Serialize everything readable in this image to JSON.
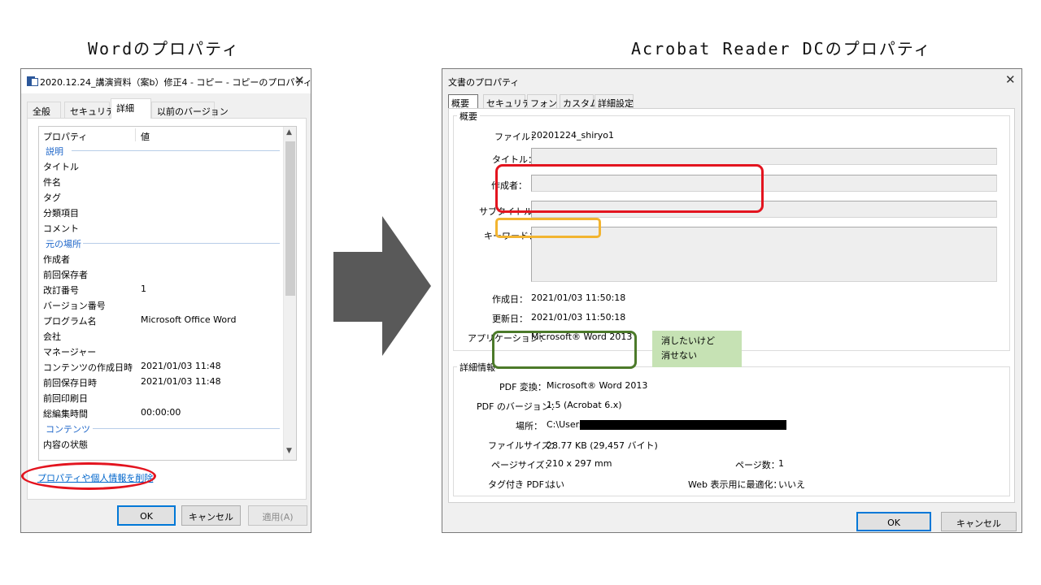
{
  "captions": {
    "left": "Wordのプロパティ",
    "right": "Acrobat Reader DCのプロパティ"
  },
  "word": {
    "title": "2020.12.24_講演資料（案b）修正4 - コピー - コピーのプロパティ",
    "tabs": [
      "全般",
      "セキュリティ",
      "詳細",
      "以前のバージョン"
    ],
    "active_tab": "詳細",
    "header": {
      "name": "プロパティ",
      "value": "値"
    },
    "groups": {
      "description": "説明",
      "origin": "元の場所",
      "content": "コンテンツ"
    },
    "rows": {
      "title": {
        "name": "タイトル",
        "value": ""
      },
      "subject": {
        "name": "件名",
        "value": ""
      },
      "tags": {
        "name": "タグ",
        "value": ""
      },
      "categories": {
        "name": "分類項目",
        "value": ""
      },
      "comments": {
        "name": "コメント",
        "value": ""
      },
      "authors": {
        "name": "作成者",
        "value": ""
      },
      "last_saved_by": {
        "name": "前回保存者",
        "value": ""
      },
      "revision": {
        "name": "改訂番号",
        "value": "1"
      },
      "version": {
        "name": "バージョン番号",
        "value": ""
      },
      "program": {
        "name": "プログラム名",
        "value": "Microsoft Office Word"
      },
      "company": {
        "name": "会社",
        "value": ""
      },
      "manager": {
        "name": "マネージャー",
        "value": ""
      },
      "content_created": {
        "name": "コンテンツの作成日時",
        "value": "2021/01/03 11:48"
      },
      "date_saved": {
        "name": "前回保存日時",
        "value": "2021/01/03 11:48"
      },
      "last_printed": {
        "name": "前回印刷日",
        "value": ""
      },
      "total_edit_time": {
        "name": "総編集時間",
        "value": "00:00:00"
      },
      "content_status": {
        "name": "内容の状態",
        "value": ""
      }
    },
    "remove_link": "プロパティや個人情報を削除",
    "buttons": {
      "ok": "OK",
      "cancel": "キャンセル",
      "apply": "適用(A)"
    }
  },
  "acrobat": {
    "title": "文書のプロパティ",
    "tabs": [
      "概要",
      "セキュリティ",
      "フォント",
      "カスタム",
      "詳細設定"
    ],
    "active_tab": "概要",
    "summary": {
      "section": "概要",
      "file_label": "ファイル：",
      "file_value": "20201224_shiryo1",
      "title_label": "タイトル：",
      "title_value": "",
      "author_label": "作成者：",
      "author_value": "",
      "subject_label": "サブタイトル：",
      "subject_value": "",
      "keywords_label": "キーワード：",
      "keywords_value": "",
      "created_label": "作成日：",
      "created_value": "2021/01/03 11:50:18",
      "modified_label": "更新日：",
      "modified_value": "2021/01/03 11:50:18",
      "application_label": "アプリケーション：",
      "application_value": "Microsoft® Word 2013"
    },
    "advanced": {
      "section": "詳細情報",
      "producer_label": "PDF 変換：",
      "producer_value": "Microsoft® Word 2013",
      "version_label": "PDF のバージョン：",
      "version_value": "1.5 (Acrobat 6.x)",
      "location_label": "場所：",
      "location_value": "C:\\Users",
      "filesize_label": "ファイルサイズ：",
      "filesize_value": "28.77 KB (29,457 バイト)",
      "pagesize_label": "ページサイズ：",
      "pagesize_value": "210 x 297 mm",
      "pages_label": "ページ数：",
      "pages_value": "1",
      "tagged_label": "タグ付き PDF：",
      "tagged_value": "はい",
      "fastweb_label": "Web 表示用に最適化：",
      "fastweb_value": "いいえ"
    },
    "note": {
      "line1": "消したいけど",
      "line2": "消せない"
    },
    "buttons": {
      "ok": "OK",
      "cancel": "キャンセル"
    }
  },
  "colors": {
    "annotation_red": "#e3141f",
    "annotation_yellow": "#f2b430",
    "annotation_green": "#4c7a2a",
    "note_background": "#c6e2b4",
    "arrow": "#595959",
    "link": "#0066cc"
  }
}
